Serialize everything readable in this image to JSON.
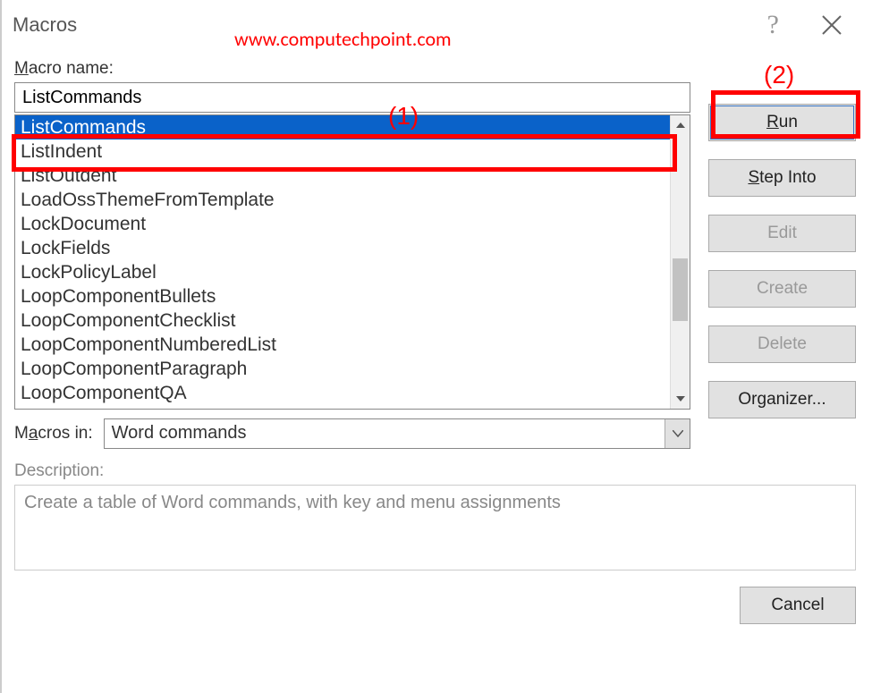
{
  "dialog": {
    "title": "Macros",
    "watermark": "www.computechpoint.com"
  },
  "labels": {
    "macro_name": "Macro name:",
    "macros_in": "Macros in:",
    "description": "Description:"
  },
  "macro_name_value": "ListCommands",
  "list_items": [
    "ListCommands",
    "ListIndent",
    "ListOutdent",
    "LoadOssThemeFromTemplate",
    "LockDocument",
    "LockFields",
    "LockPolicyLabel",
    "LoopComponentBullets",
    "LoopComponentChecklist",
    "LoopComponentNumberedList",
    "LoopComponentParagraph",
    "LoopComponentQA"
  ],
  "selected_index": 0,
  "macros_in_value": "Word commands",
  "description_value": "Create a table of Word commands, with key and menu assignments",
  "buttons": {
    "run": "Run",
    "step_into": "Step Into",
    "edit": "Edit",
    "create": "Create",
    "delete": "Delete",
    "organizer": "Organizer...",
    "cancel": "Cancel"
  },
  "annotations": {
    "one": "(1)",
    "two": "(2)"
  }
}
